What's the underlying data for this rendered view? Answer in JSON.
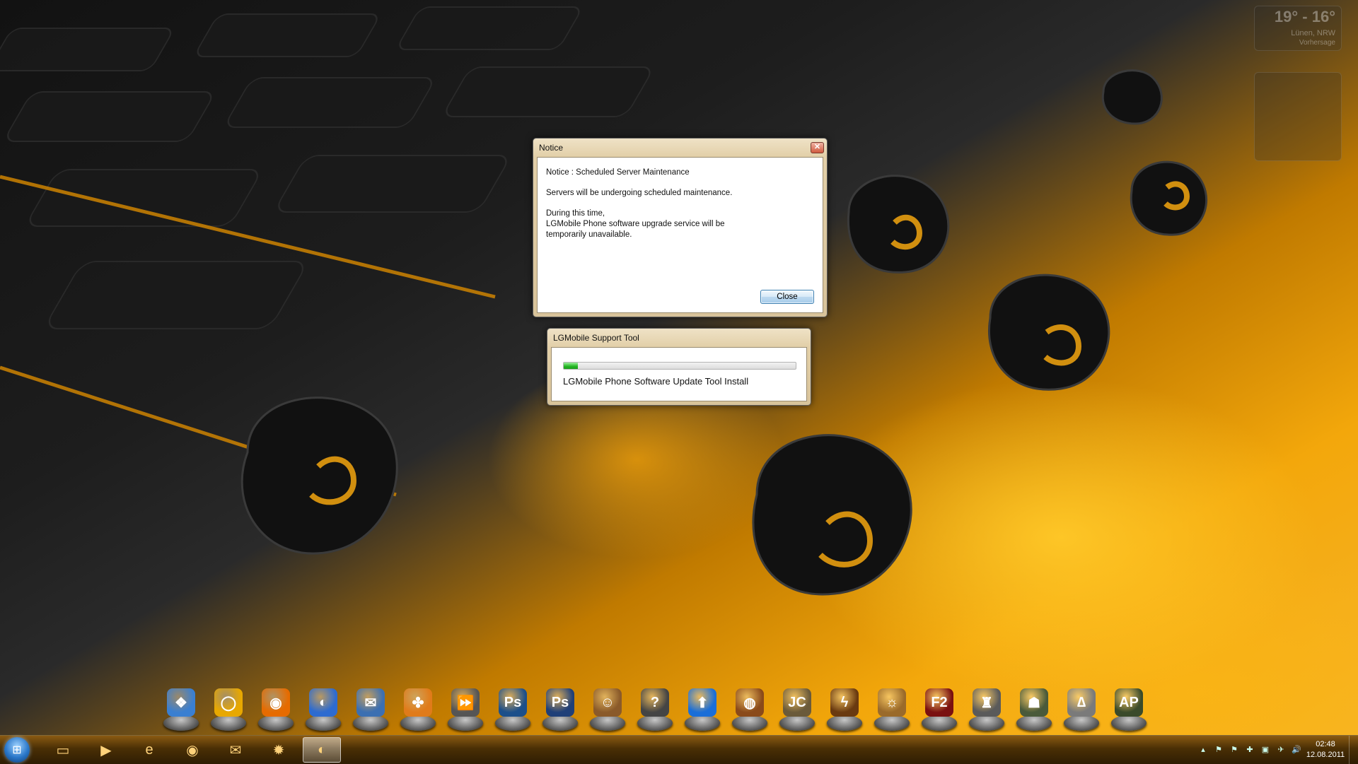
{
  "notice_dialog": {
    "title": "Notice",
    "heading": "Notice : Scheduled Server Maintenance",
    "line1": "Servers will be undergoing scheduled maintenance.",
    "line2a": "During this time,",
    "line2b": "LGMobile Phone software upgrade service will be",
    "line2c": "temporarily unavailable.",
    "close_label": "Close",
    "close_glyph": "✕"
  },
  "support_tool": {
    "title": "LGMobile Support Tool",
    "progress_percent": 6,
    "status": "LGMobile Phone Software Update Tool Install"
  },
  "weather_widget": {
    "temps": "19° - 16°",
    "location": "Lünen, NRW",
    "forecast_label": "Vorhersage"
  },
  "dock": {
    "icons": [
      {
        "name": "windows-icon",
        "glyph": "❖",
        "color": "#3a7fd1"
      },
      {
        "name": "ring-icon",
        "glyph": "◯",
        "color": "#e8a800"
      },
      {
        "name": "firefox-icon",
        "glyph": "◉",
        "color": "#e66b00"
      },
      {
        "name": "google-earth-icon",
        "glyph": "◐",
        "color": "#2d6bd0"
      },
      {
        "name": "thunderbird-icon",
        "glyph": "✉",
        "color": "#3b6fb2"
      },
      {
        "name": "clover-icon",
        "glyph": "✤",
        "color": "#e07b1a"
      },
      {
        "name": "media-player-icon",
        "glyph": "⏩",
        "color": "#555"
      },
      {
        "name": "photoshop-icon",
        "glyph": "Ps",
        "color": "#1c4f8a"
      },
      {
        "name": "photoshop-alt-icon",
        "glyph": "Ps",
        "color": "#1f3f78"
      },
      {
        "name": "monkey-icon",
        "glyph": "☺",
        "color": "#8a5a2a"
      },
      {
        "name": "help-icon",
        "glyph": "?",
        "color": "#444"
      },
      {
        "name": "upload-arrow-icon",
        "glyph": "⬆",
        "color": "#1a6ed8"
      },
      {
        "name": "game-orange-icon",
        "glyph": "◍",
        "color": "#8a4a1a"
      },
      {
        "name": "just-cause-icon",
        "glyph": "JC",
        "color": "#6a5a3a"
      },
      {
        "name": "lightning-game-icon",
        "glyph": "ϟ",
        "color": "#6a3a10"
      },
      {
        "name": "bronze-emblem-icon",
        "glyph": "☼",
        "color": "#9a6a2a"
      },
      {
        "name": "fear2-icon",
        "glyph": "F2",
        "color": "#7a1010"
      },
      {
        "name": "soldier-icon",
        "glyph": "♜",
        "color": "#5a5a5a"
      },
      {
        "name": "military-game-icon",
        "glyph": "☗",
        "color": "#4a5a3a"
      },
      {
        "name": "assassin-icon",
        "glyph": "∆",
        "color": "#7a7a7a"
      },
      {
        "name": "predator-game-icon",
        "glyph": "AP",
        "color": "#3a4a2a"
      }
    ]
  },
  "taskbar": {
    "start_glyph": "⊞",
    "buttons": [
      {
        "name": "explorer-icon",
        "glyph": "▭",
        "active": false
      },
      {
        "name": "media-icon",
        "glyph": "▶",
        "active": false
      },
      {
        "name": "internet-explorer-icon",
        "glyph": "e",
        "active": false
      },
      {
        "name": "firefox-icon",
        "glyph": "◉",
        "active": false
      },
      {
        "name": "thunderbird-icon",
        "glyph": "✉",
        "active": false
      },
      {
        "name": "splat-icon",
        "glyph": "✹",
        "active": false
      },
      {
        "name": "lg-icon",
        "glyph": "◐",
        "active": true
      }
    ],
    "tray_icons": [
      "▴",
      "⚑",
      "⚑",
      "✚",
      "▣",
      "✈",
      "🔊"
    ],
    "time": "02:48",
    "date": "12.08.2011"
  }
}
